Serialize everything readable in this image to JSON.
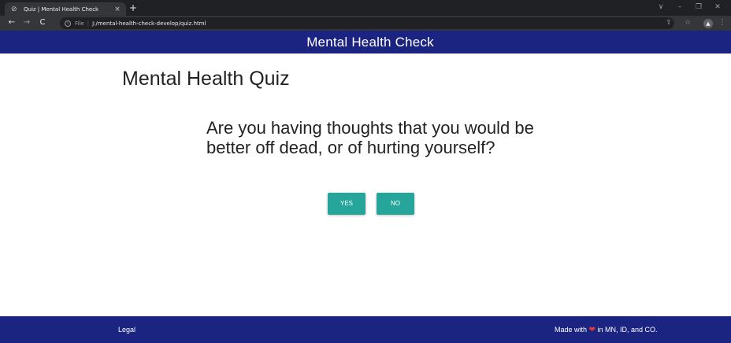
{
  "browser": {
    "tab_title": "Quiz | Mental Health Check",
    "tab_close": "×",
    "new_tab": "+",
    "url_scheme": "File",
    "url_separator": "|",
    "url": "J:/mental-health-check-develop/quiz.html",
    "window_controls": {
      "menu": "∨",
      "minimize": "–",
      "restore": "❐",
      "close": "✕"
    },
    "nav": {
      "back": "←",
      "forward": "→",
      "reload": "C"
    },
    "toolbar_icons": {
      "share": "⇪",
      "star": "☆",
      "profile": "●",
      "menu": "⋮"
    }
  },
  "header": {
    "site_title": "Mental Health Check",
    "background": "#1c2481"
  },
  "quiz": {
    "title": "Mental Health Quiz",
    "question": "Are you having thoughts that you would be better off dead, or of hurting yourself?",
    "answers": {
      "yes_label": "YES",
      "no_label": "NO"
    },
    "button_color": "#26a69a"
  },
  "footer": {
    "legal_label": "Legal",
    "made_with_prefix": "Made with",
    "heart": "❤",
    "made_with_suffix": "in MN, ID, and CO.",
    "heart_color": "#e53935"
  }
}
